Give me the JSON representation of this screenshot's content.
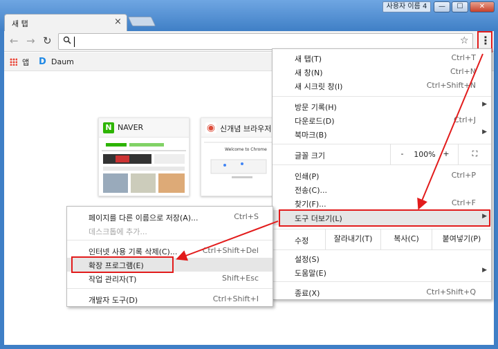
{
  "window": {
    "profile_name": "사용자 이름 4",
    "minimize": "—",
    "maximize": "☐",
    "close": "✕"
  },
  "tab": {
    "title": "새 탭",
    "close": "×"
  },
  "toolbar": {
    "back": "←",
    "forward": "→",
    "reload": "↻",
    "search_icon": "🔍",
    "star_icon": "☆",
    "menu_icon": "⋮"
  },
  "bookmarks": [
    {
      "label": "앱",
      "icon": "apps-grid-icon"
    },
    {
      "label": "Daum",
      "icon": "daum-icon",
      "glyph": "D"
    }
  ],
  "thumbnails": [
    {
      "title": "NAVER",
      "logo": "N",
      "color": "#2db400"
    },
    {
      "title": "신개념 브라우저",
      "logo": "◉",
      "color": "#dd4b39",
      "shot_text": "Welcome to Chrome"
    }
  ],
  "menu": {
    "items_top": [
      {
        "label": "새 탭(T)",
        "shortcut": "Ctrl+T"
      },
      {
        "label": "새 창(N)",
        "shortcut": "Ctrl+N"
      },
      {
        "label": "새 시크릿 창(I)",
        "shortcut": "Ctrl+Shift+N"
      }
    ],
    "items_history": [
      {
        "label": "방문 기록(H)",
        "arrow": "▶"
      },
      {
        "label": "다운로드(D)",
        "shortcut": "Ctrl+J"
      },
      {
        "label": "북마크(B)",
        "arrow": "▶"
      }
    ],
    "zoom": {
      "label": "글꼴 크기",
      "minus": "-",
      "value": "100%",
      "plus": "+",
      "fullscreen": "⛶"
    },
    "items_tools": [
      {
        "label": "인쇄(P)",
        "shortcut": "Ctrl+P"
      },
      {
        "label": "전송(C)..."
      },
      {
        "label": "찾기(F)...",
        "shortcut": "Ctrl+F"
      },
      {
        "label": "도구 더보기(L)",
        "arrow": "▶"
      }
    ],
    "edit": {
      "label": "수정",
      "cut": "잘라내기(T)",
      "copy": "복사(C)",
      "paste": "붙여넣기(P)"
    },
    "items_bottom": [
      {
        "label": "설정(S)"
      },
      {
        "label": "도움말(E)",
        "arrow": "▶"
      }
    ],
    "exit": {
      "label": "종료(X)",
      "shortcut": "Ctrl+Shift+Q"
    }
  },
  "submenu": {
    "items": [
      {
        "label": "페이지를 다른 이름으로 저장(A)...",
        "shortcut": "Ctrl+S"
      },
      {
        "label": "데스크톱에 추가..."
      },
      {
        "label": "인터넷 사용 기록 삭제(C)...",
        "shortcut": "Ctrl+Shift+Del"
      },
      {
        "label": "확장 프로그램(E)"
      },
      {
        "label": "작업 관리자(T)",
        "shortcut": "Shift+Esc"
      },
      {
        "label": "개발자 도구(D)",
        "shortcut": "Ctrl+Shift+I"
      }
    ]
  },
  "colors": {
    "highlight_red": "#e21b1b",
    "frame_blue": "#3f7fc6"
  }
}
